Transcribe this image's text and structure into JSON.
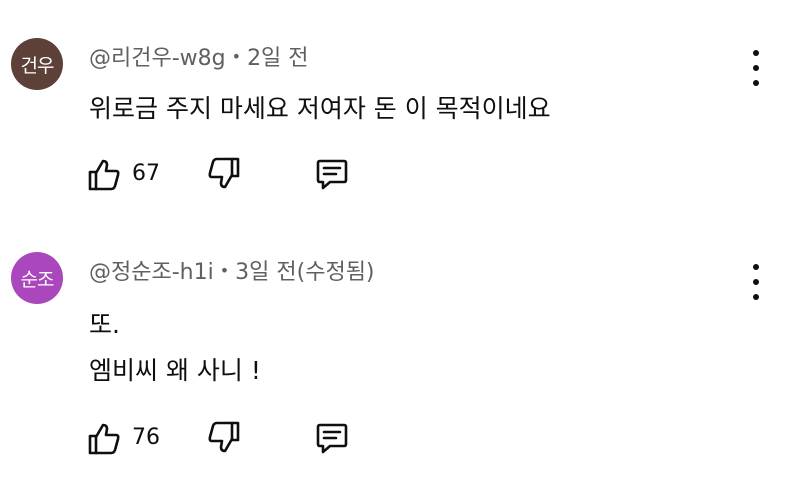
{
  "comments": [
    {
      "avatar_text": "건우",
      "avatar_color": "#5d4037",
      "author": "@리건우-w8g",
      "time": "2일 전",
      "lines": [
        "위로금 주지 마세요  저여자 돈 이 목적이네요"
      ],
      "likes": "67"
    },
    {
      "avatar_text": "순조",
      "avatar_color": "#ab47bc",
      "author": "@정순조-h1i",
      "time": "3일 전(수정됨)",
      "lines": [
        "또.",
        "엠비씨 왜 사니 !"
      ],
      "likes": "76"
    }
  ],
  "icons": {
    "like": "thumbs-up-icon",
    "dislike": "thumbs-down-icon",
    "reply": "reply-comment-icon",
    "menu": "more-vert-icon"
  },
  "meta_separator": "•"
}
